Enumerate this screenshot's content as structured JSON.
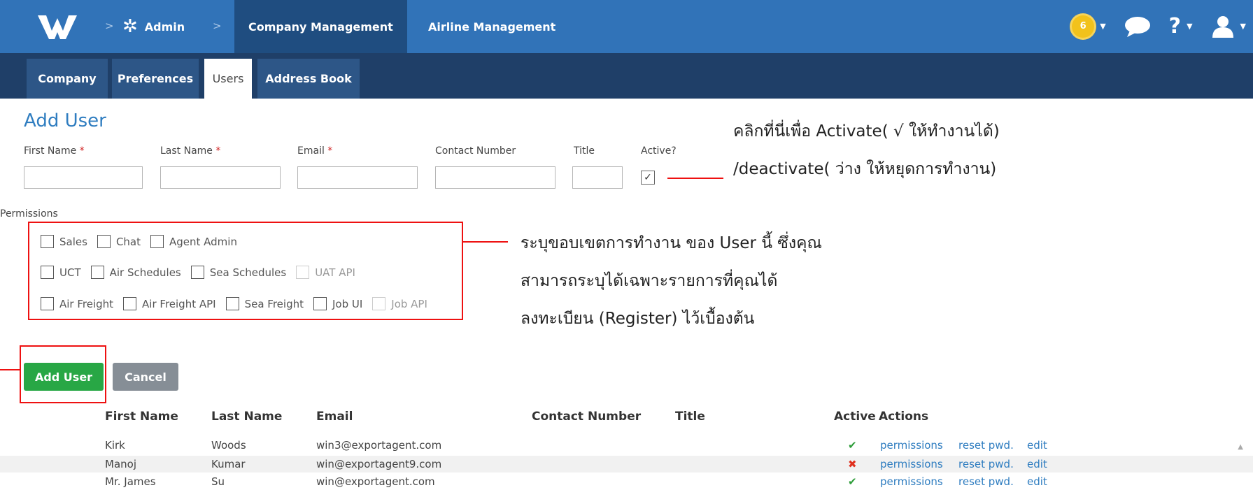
{
  "topbar": {
    "admin_label": "Admin",
    "crumb_sep": ">",
    "tabs": [
      {
        "label": "Company Management"
      },
      {
        "label": "Airline Management"
      }
    ],
    "notif_count": "6",
    "icons": [
      "logo-icon",
      "gear-icon",
      "notification-icon",
      "chat-icon",
      "help-icon",
      "user-icon"
    ],
    "colors": {
      "primary": "#3173b8",
      "dark": "#1f4d80",
      "subbar": "#1f3f68"
    }
  },
  "subtabs": [
    {
      "label": "Company"
    },
    {
      "label": "Preferences"
    },
    {
      "label": "Users"
    },
    {
      "label": "Address Book"
    }
  ],
  "form": {
    "title": "Add User",
    "fields": [
      {
        "label": "First Name",
        "required": "*"
      },
      {
        "label": "Last Name",
        "required": "*"
      },
      {
        "label": "Email",
        "required": "*"
      },
      {
        "label": "Contact Number"
      },
      {
        "label": "Title"
      },
      {
        "label": "Active?"
      }
    ],
    "active_checked": "✓",
    "permissions_label": "Permissions",
    "permissions": [
      [
        {
          "label": "Sales"
        },
        {
          "label": "Chat"
        },
        {
          "label": "Agent Admin"
        }
      ],
      [
        {
          "label": "UCT"
        },
        {
          "label": "Air Schedules"
        },
        {
          "label": "Sea Schedules"
        },
        {
          "label": "UAT API",
          "disabled": true
        }
      ],
      [
        {
          "label": "Air Freight"
        },
        {
          "label": "Air Freight API"
        },
        {
          "label": "Sea Freight"
        },
        {
          "label": "Job UI"
        },
        {
          "label": "Job API",
          "disabled": true
        }
      ]
    ],
    "add_button": "Add User",
    "cancel_button": "Cancel"
  },
  "annotations": {
    "activate_line1": "คลิกที่นี่เพื่อ Activate( √ ให้ทำงานได้)",
    "activate_line2": "/deactivate( ว่าง ให้หยุดการทำงาน)",
    "perm_line1": "ระบุขอบเขตการทำงาน ของ  User นี้ ซึ่งคุณ",
    "perm_line2": "สามารถระบุได้เฉพาะรายการที่คุณได้",
    "perm_line3": "ลงทะเบียน (Register) ไว้เบื้องต้น"
  },
  "table": {
    "headers": [
      "First Name",
      "Last Name",
      "Email",
      "Contact Number",
      "Title",
      "Active",
      "Actions"
    ],
    "rows": [
      {
        "first": "Kirk",
        "last": "Woods",
        "email": "win3@exportagent.com",
        "active": "✔",
        "active_state": "yes"
      },
      {
        "first": "Manoj",
        "last": "Kumar",
        "email": "win@exportagent9.com",
        "active": "✖",
        "active_state": "no"
      },
      {
        "first": "Mr. James",
        "last": "Su",
        "email": "win@exportagent.com",
        "active": "✔",
        "active_state": "yes"
      }
    ],
    "actions": {
      "permissions": "permissions",
      "reset": "reset pwd.",
      "edit": "edit"
    }
  }
}
